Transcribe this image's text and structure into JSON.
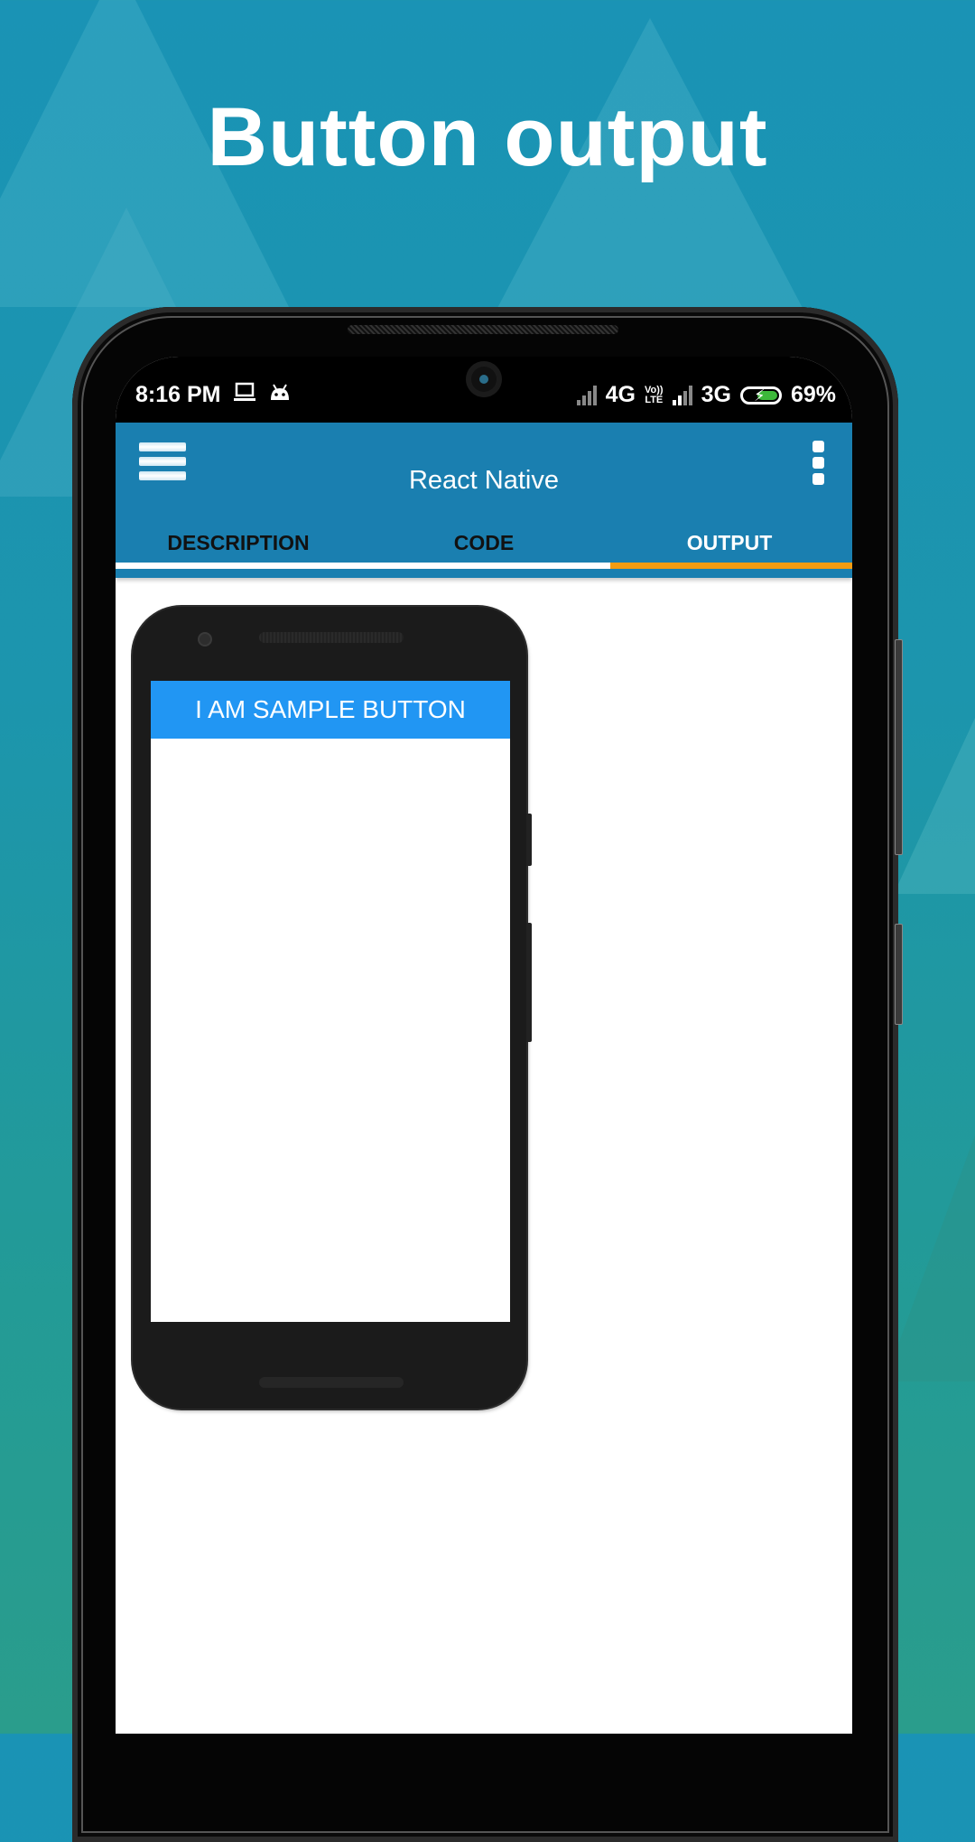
{
  "heading": "Button output",
  "status_bar": {
    "time": "8:16 PM",
    "network1": "4G",
    "volte_top": "Vo))",
    "volte_bottom": "LTE",
    "network2": "3G",
    "battery": "69%",
    "icons": [
      "laptop-icon",
      "android-icon",
      "signal-icon",
      "signal-icon",
      "battery-charging-icon"
    ]
  },
  "app_bar": {
    "title": "React Native",
    "menu_icon": "hamburger-menu-icon",
    "overflow_icon": "more-vert-icon"
  },
  "tabs": [
    {
      "label": "DESCRIPTION",
      "active": false
    },
    {
      "label": "CODE",
      "active": false
    },
    {
      "label": "OUTPUT",
      "active": true
    }
  ],
  "colors": {
    "app_bar": "#1a7fb0",
    "tab_indicator": "#f39c12",
    "sample_button": "#2196f3",
    "battery_fill": "#3db83a"
  },
  "preview": {
    "sample_button_label": "I AM SAMPLE BUTTON"
  }
}
